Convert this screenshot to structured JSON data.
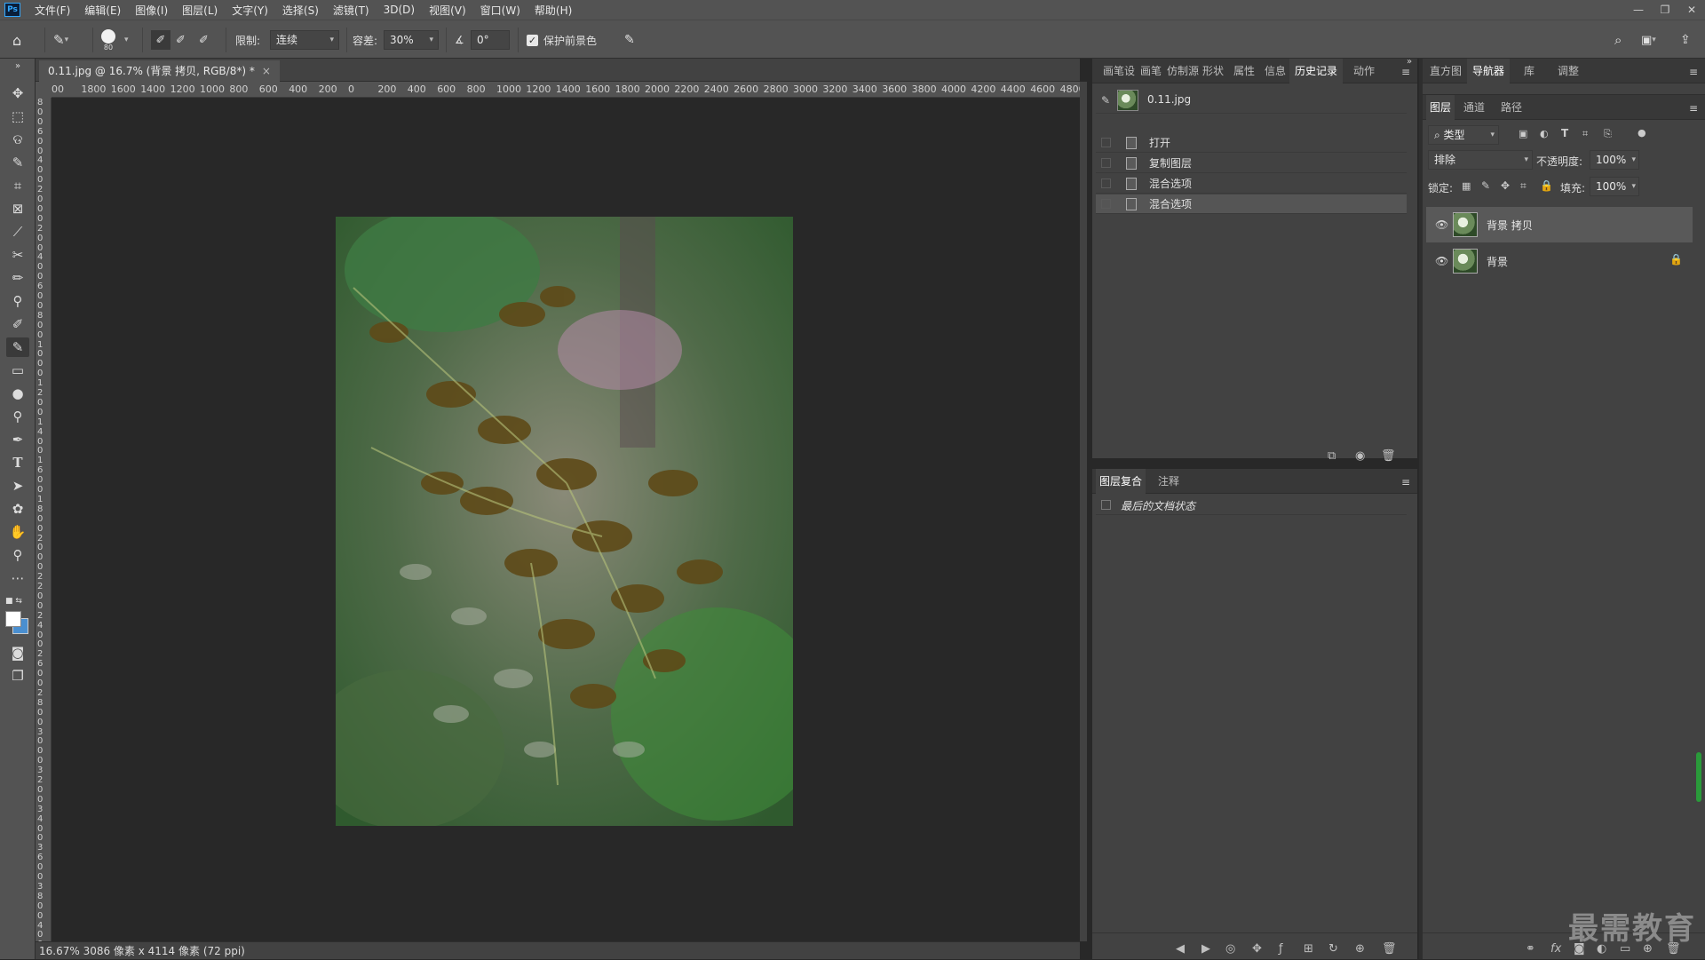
{
  "app": {
    "logo": "Ps",
    "menu": [
      "文件(F)",
      "编辑(E)",
      "图像(I)",
      "图层(L)",
      "文字(Y)",
      "选择(S)",
      "滤镜(T)",
      "3D(D)",
      "视图(V)",
      "窗口(W)",
      "帮助(H)"
    ],
    "window_controls": [
      "—",
      "❐",
      "✕"
    ]
  },
  "options": {
    "brush_size": "80",
    "limit_label": "限制:",
    "limit_value": "连续",
    "tolerance_label": "容差:",
    "tolerance_value": "30%",
    "angle_value": "0°",
    "protect_label": "保护前景色"
  },
  "document": {
    "tab_title": "0.11.jpg @ 16.7% (背景 拷贝, RGB/8*) *",
    "tab_close": "×",
    "ruler_h": [
      "00",
      "1800",
      "1600",
      "1400",
      "1200",
      "1000",
      "800",
      "600",
      "400",
      "200",
      "0",
      "200",
      "400",
      "600",
      "800",
      "1000",
      "1200",
      "1400",
      "1600",
      "1800",
      "2000",
      "2200",
      "2400",
      "2600",
      "2800",
      "3000",
      "3200",
      "3400",
      "3600",
      "3800",
      "4000",
      "4200",
      "4400",
      "4600",
      "4800"
    ],
    "ruler_v": [
      "8",
      "0",
      "0",
      "6",
      "0",
      "0",
      "4",
      "0",
      "0",
      "2",
      "0",
      "0",
      "0",
      "2",
      "0",
      "0",
      "4",
      "0",
      "0",
      "6",
      "0",
      "0",
      "8",
      "0",
      "0",
      "1",
      "0",
      "0",
      "0",
      "1",
      "2",
      "0",
      "0",
      "1",
      "4",
      "0",
      "0",
      "1",
      "6",
      "0",
      "0",
      "1",
      "8",
      "0",
      "0",
      "2",
      "0",
      "0",
      "0",
      "2",
      "2",
      "0",
      "0",
      "2",
      "4",
      "0",
      "0",
      "2",
      "6",
      "0",
      "0",
      "2",
      "8",
      "0",
      "0",
      "3",
      "0",
      "0",
      "0",
      "3",
      "2",
      "0",
      "0",
      "3",
      "4",
      "0",
      "0",
      "3",
      "6",
      "0",
      "0",
      "3",
      "8",
      "0",
      "0",
      "4",
      "0",
      "0",
      "0"
    ],
    "status": "16.67%  3086 像素 x 4114 像素 (72 ppi)"
  },
  "history_panel": {
    "tabs": [
      "画笔设",
      "画笔",
      "仿制源",
      "形状",
      "属性",
      "信息",
      "历史记录",
      "动作"
    ],
    "active_tab": "历史记录",
    "snapshot": "0.11.jpg",
    "items": [
      "打开",
      "复制图层",
      "混合选项",
      "混合选项"
    ],
    "selected_index": 3
  },
  "comps_panel": {
    "tabs": [
      "图层复合",
      "注释"
    ],
    "active_tab": "图层复合",
    "item": "最后的文档状态"
  },
  "right_top_tabs": {
    "tabs": [
      "直方图",
      "导航器",
      "库",
      "调整"
    ],
    "active_tab": "导航器"
  },
  "layers_panel": {
    "tabs": [
      "图层",
      "通道",
      "路径"
    ],
    "active_tab": "图层",
    "filter_kind": "类型",
    "blend_mode": "排除",
    "opacity_label": "不透明度:",
    "opacity_value": "100%",
    "lock_label": "锁定:",
    "fill_label": "填充:",
    "fill_value": "100%",
    "layers": [
      {
        "name": "背景 拷贝",
        "selected": true,
        "locked": false
      },
      {
        "name": "背景",
        "selected": false,
        "locked": true
      }
    ]
  },
  "watermark": "最需教育",
  "colors": {
    "ui_dark": "#282828",
    "ui_panel": "#424242",
    "ui_bar": "#535353",
    "accent": "#31a8ff"
  }
}
